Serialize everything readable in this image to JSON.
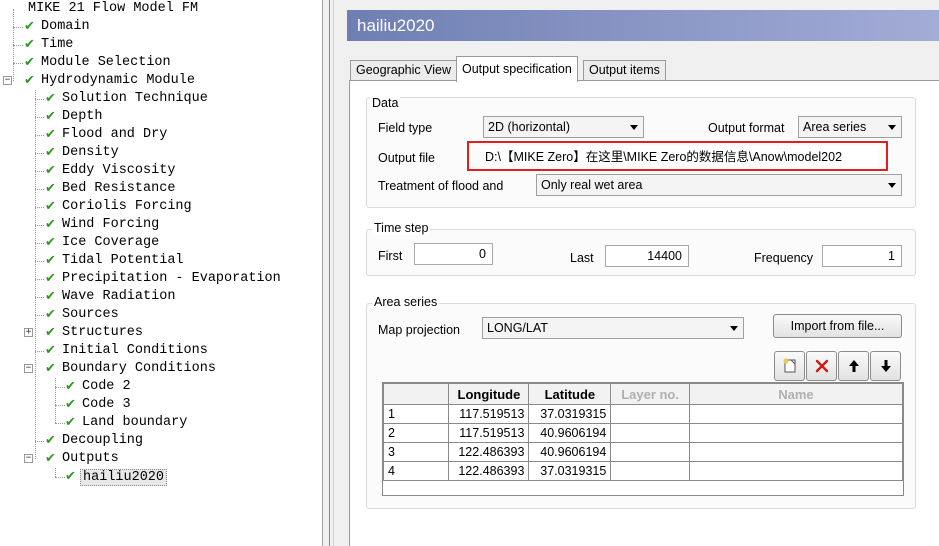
{
  "tree": {
    "items": [
      {
        "label": "MIKE 21 Flow Model FM"
      },
      {
        "label": "Domain"
      },
      {
        "label": "Time"
      },
      {
        "label": "Module Selection"
      },
      {
        "label": "Hydrodynamic Module"
      },
      {
        "label": "Solution Technique"
      },
      {
        "label": "Depth"
      },
      {
        "label": "Flood and Dry"
      },
      {
        "label": "Density"
      },
      {
        "label": "Eddy Viscosity"
      },
      {
        "label": "Bed Resistance"
      },
      {
        "label": "Coriolis Forcing"
      },
      {
        "label": "Wind Forcing"
      },
      {
        "label": "Ice Coverage"
      },
      {
        "label": "Tidal Potential"
      },
      {
        "label": "Precipitation - Evaporation"
      },
      {
        "label": "Wave Radiation"
      },
      {
        "label": "Sources"
      },
      {
        "label": "Structures"
      },
      {
        "label": "Initial Conditions"
      },
      {
        "label": "Boundary Conditions"
      },
      {
        "label": "Code 2"
      },
      {
        "label": "Code 3"
      },
      {
        "label": "Land boundary"
      },
      {
        "label": "Decoupling"
      },
      {
        "label": "Outputs"
      },
      {
        "label": "hailiu2020"
      }
    ]
  },
  "panel": {
    "title": "hailiu2020",
    "tabs": [
      {
        "label": "Geographic View"
      },
      {
        "label": "Output specification"
      },
      {
        "label": "Output items"
      }
    ]
  },
  "data_group": {
    "title": "Data",
    "field_type_label": "Field type",
    "field_type_value": "2D (horizontal)",
    "output_format_label": "Output format",
    "output_format_value": "Area series",
    "output_file_label": "Output file",
    "output_file_value": "D:\\【MIKE Zero】在这里\\MIKE Zero的数据信息\\Anow\\model202",
    "flood_label": "Treatment of flood and",
    "flood_value": "Only real wet area"
  },
  "time_group": {
    "title": "Time step",
    "first_label": "First",
    "first_value": "0",
    "last_label": "Last",
    "last_value": "14400",
    "frequency_label": "Frequency",
    "frequency_value": "1"
  },
  "area_group": {
    "title": "Area series",
    "map_projection_label": "Map projection",
    "map_projection_value": "LONG/LAT",
    "import_label": "Import from file...",
    "columns": [
      "",
      "Longitude",
      "Latitude",
      "Layer no.",
      "Name"
    ],
    "rows": [
      {
        "id": "1",
        "lon": "117.519513",
        "lat": "37.0319315"
      },
      {
        "id": "2",
        "lon": "117.519513",
        "lat": "40.9606194"
      },
      {
        "id": "3",
        "lon": "122.486393",
        "lat": "40.9606194"
      },
      {
        "id": "4",
        "lon": "122.486393",
        "lat": "37.0319315"
      }
    ]
  },
  "icons": {
    "check": "checkmark-icon",
    "new": "new-row-icon",
    "delete": "delete-icon",
    "up": "arrow-up-icon",
    "down": "arrow-down-icon"
  },
  "colors": {
    "check_green": "#2a9a1e",
    "title_gradient_start": "#6f7fb3",
    "highlight_red": "#e02020"
  }
}
